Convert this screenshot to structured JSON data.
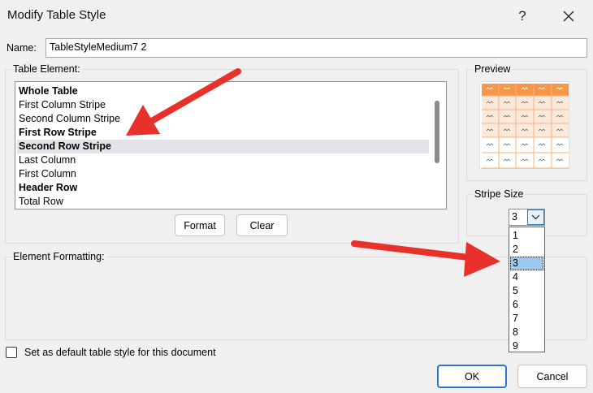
{
  "window": {
    "title": "Modify Table Style",
    "help_symbol": "?"
  },
  "name": {
    "label": "Name:",
    "value": "TableStyleMedium7 2"
  },
  "table_element": {
    "title": "Table Element:",
    "items": [
      {
        "label": "Whole Table",
        "bold": true,
        "selected": false
      },
      {
        "label": "First Column Stripe",
        "bold": false,
        "selected": false
      },
      {
        "label": "Second Column Stripe",
        "bold": false,
        "selected": false
      },
      {
        "label": "First Row Stripe",
        "bold": true,
        "selected": false
      },
      {
        "label": "Second Row Stripe",
        "bold": true,
        "selected": true
      },
      {
        "label": "Last Column",
        "bold": false,
        "selected": false
      },
      {
        "label": "First Column",
        "bold": false,
        "selected": false
      },
      {
        "label": "Header Row",
        "bold": true,
        "selected": false
      },
      {
        "label": "Total Row",
        "bold": false,
        "selected": false
      }
    ],
    "format_button": "Format",
    "clear_button": "Clear"
  },
  "preview": {
    "title": "Preview",
    "colors": {
      "header": "#f79646",
      "stripe": "#fde9d9",
      "grid": "#f4b183"
    }
  },
  "stripe_size": {
    "title": "Stripe Size",
    "selected_value": "3",
    "options": [
      "1",
      "2",
      "3",
      "4",
      "5",
      "6",
      "7",
      "8",
      "9"
    ],
    "selected_index": 2
  },
  "element_formatting": {
    "title": "Element Formatting:"
  },
  "default_checkbox": {
    "label": "Set as default table style for this document",
    "checked": false
  },
  "buttons": {
    "ok": "OK",
    "cancel": "Cancel"
  },
  "annotations": {
    "arrow_color": "#e8312a"
  }
}
